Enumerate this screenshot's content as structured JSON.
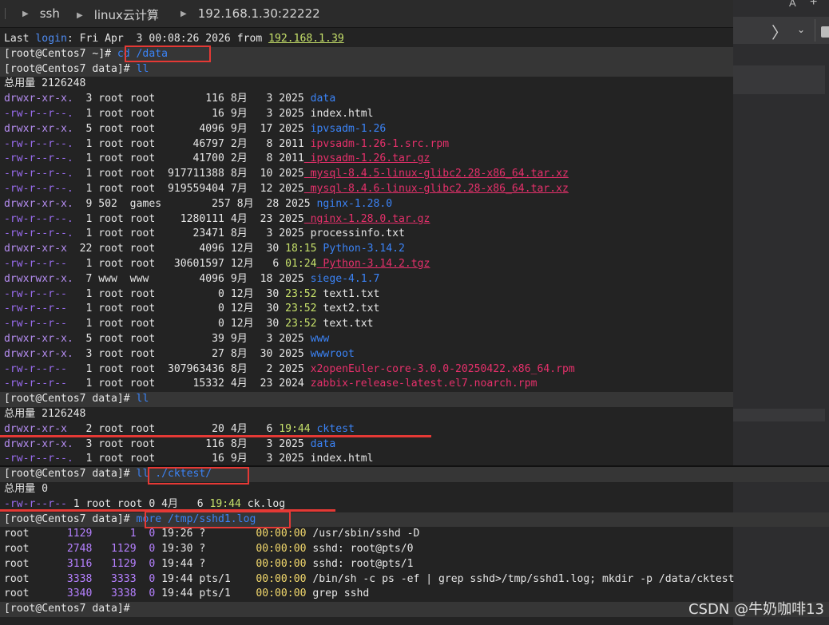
{
  "breadcrumb": [
    "ssh",
    "linux云计算",
    "192.168.1.30:22222"
  ],
  "right_panel": {
    "a_label": "A",
    "plus_label": "+",
    "chevron": "〉",
    "down": "⌄"
  },
  "login": {
    "prefix": "Last ",
    "word": "login",
    "text": ": Fri Apr  3 00:08:26 2026 from ",
    "ip": "192.168.1.39"
  },
  "prompt": "[root@Centos7 data]#",
  "prompt_home": "[root@Centos7 ~]#",
  "cmd1": "cd /data",
  "cmd2": "ll",
  "total1": "总用量 2126248",
  "listing1": [
    {
      "perm": "drwxr-xr-x.",
      "n": " 3",
      "u": "root",
      "g": "root",
      "size": "      116",
      "mon": "8月",
      "day": " 3",
      "time": "2025",
      "name": "data",
      "cls": "c-blue"
    },
    {
      "perm": "-rw-r--r--.",
      "n": " 1",
      "u": "root",
      "g": "root",
      "size": "       16",
      "mon": "9月",
      "day": " 3",
      "time": "2025",
      "name": "index.html",
      "cls": "num"
    },
    {
      "perm": "drwxr-xr-x.",
      "n": " 5",
      "u": "root",
      "g": "root",
      "size": "     4096",
      "mon": "9月",
      "day": "17",
      "time": "2025",
      "name": "ipvsadm-1.26",
      "cls": "c-blue"
    },
    {
      "perm": "-rw-r--r--.",
      "n": " 1",
      "u": "root",
      "g": "root",
      "size": "    46797",
      "mon": "2月",
      "day": " 8",
      "time": "2011",
      "name": "ipvsadm-1.26-1.src.rpm",
      "cls": "c-red"
    },
    {
      "perm": "-rw-r--r--.",
      "n": " 1",
      "u": "root",
      "g": "root",
      "size": "    41700",
      "mon": "2月",
      "day": " 8",
      "time": "2011",
      "name": "ipvsadm-1.26.tar.gz",
      "cls": "c-redu"
    },
    {
      "perm": "-rw-r--r--.",
      "n": " 1",
      "u": "root",
      "g": "root",
      "size": "917711388",
      "mon": "8月",
      "day": "10",
      "time": "2025",
      "name": "mysql-8.4.5-linux-glibc2.28-x86_64.tar.xz",
      "cls": "c-redu"
    },
    {
      "perm": "-rw-r--r--.",
      "n": " 1",
      "u": "root",
      "g": "root",
      "size": "919559404",
      "mon": "7月",
      "day": "12",
      "time": "2025",
      "name": "mysql-8.4.6-linux-glibc2.28-x86_64.tar.xz",
      "cls": "c-redu"
    },
    {
      "perm": "drwxr-xr-x.",
      "n": " 9",
      "u": "502 ",
      "g": "games",
      "size": "      257",
      "mon": "8月",
      "day": "28",
      "time": "2025",
      "name": "nginx-1.28.0",
      "cls": "c-blue"
    },
    {
      "perm": "-rw-r--r--.",
      "n": " 1",
      "u": "root",
      "g": "root",
      "size": "  1280111",
      "mon": "4月",
      "day": "23",
      "time": "2025",
      "name": "nginx-1.28.0.tar.gz",
      "cls": "c-redu"
    },
    {
      "perm": "-rw-r--r--.",
      "n": " 1",
      "u": "root",
      "g": "root",
      "size": "    23471",
      "mon": "8月",
      "day": " 3",
      "time": "2025",
      "name": "processinfo.txt",
      "cls": "num"
    },
    {
      "perm": "drwxr-xr-x ",
      "n": "22",
      "u": "root",
      "g": "root",
      "size": "     4096",
      "mon": "12月",
      "day": "30",
      "time": "18:15",
      "name": "Python-3.14.2",
      "cls": "c-blue"
    },
    {
      "perm": "-rw-r--r-- ",
      "n": " 1",
      "u": "root",
      "g": "root",
      "size": " 30601597",
      "mon": "12月",
      "day": " 6",
      "time": "01:24",
      "name": "Python-3.14.2.tgz",
      "cls": "c-redu"
    },
    {
      "perm": "drwxrwxr-x.",
      "n": " 7",
      "u": "www ",
      "g": "www ",
      "size": "     4096",
      "mon": "9月",
      "day": "18",
      "time": "2025",
      "name": "siege-4.1.7",
      "cls": "c-blue"
    },
    {
      "perm": "-rw-r--r-- ",
      "n": " 1",
      "u": "root",
      "g": "root",
      "size": "        0",
      "mon": "12月",
      "day": "30",
      "time": "23:52",
      "name": "text1.txt",
      "cls": "num"
    },
    {
      "perm": "-rw-r--r-- ",
      "n": " 1",
      "u": "root",
      "g": "root",
      "size": "        0",
      "mon": "12月",
      "day": "30",
      "time": "23:52",
      "name": "text2.txt",
      "cls": "num"
    },
    {
      "perm": "-rw-r--r-- ",
      "n": " 1",
      "u": "root",
      "g": "root",
      "size": "        0",
      "mon": "12月",
      "day": "30",
      "time": "23:52",
      "name": "text.txt",
      "cls": "num"
    },
    {
      "perm": "drwxr-xr-x.",
      "n": " 5",
      "u": "root",
      "g": "root",
      "size": "       39",
      "mon": "9月",
      "day": " 3",
      "time": "2025",
      "name": "www",
      "cls": "c-blue"
    },
    {
      "perm": "drwxr-xr-x.",
      "n": " 3",
      "u": "root",
      "g": "root",
      "size": "       27",
      "mon": "8月",
      "day": "30",
      "time": "2025",
      "name": "wwwroot",
      "cls": "c-blue"
    },
    {
      "perm": "-rw-r--r-- ",
      "n": " 1",
      "u": "root",
      "g": "root",
      "size": "307963436",
      "mon": "8月",
      "day": " 2",
      "time": "2025",
      "name": "x2openEuler-core-3.0.0-20250422.x86_64.rpm",
      "cls": "c-red"
    },
    {
      "perm": "-rw-r--r-- ",
      "n": " 1",
      "u": "root",
      "g": "root",
      "size": "    15332",
      "mon": "4月",
      "day": "23",
      "time": "2024",
      "name": "zabbix-release-latest.el7.noarch.rpm",
      "cls": "c-red"
    }
  ],
  "total2": "总用量 2126248",
  "listing2": [
    {
      "perm": "drwxr-xr-x ",
      "n": " 2",
      "u": "root",
      "g": "root",
      "size": "       20",
      "mon": "4月",
      "day": " 6",
      "time": "19:44",
      "name": "cktest",
      "cls": "c-blue"
    },
    {
      "perm": "drwxr-xr-x.",
      "n": " 3",
      "u": "root",
      "g": "root",
      "size": "      116",
      "mon": "8月",
      "day": " 3",
      "time": "2025",
      "name": "data",
      "cls": "c-blue"
    },
    {
      "perm": "-rw-r--r--.",
      "n": " 1",
      "u": "root",
      "g": "root",
      "size": "       16",
      "mon": "9月",
      "day": " 3",
      "time": "2025",
      "name": "index.html",
      "cls": "num"
    }
  ],
  "cmd3": "ll ./cktest/",
  "total3": "总用量 0",
  "ck_line": {
    "perm": "-rw-r--r--",
    "n": "1",
    "u": "root",
    "g": "root",
    "size": "0",
    "mon": "4月",
    "day": "6",
    "time": "19:44",
    "name": "ck.log"
  },
  "cmd4": "more /tmp/sshd1.log",
  "ps_rows": [
    {
      "user": "root",
      "pid": "1129",
      "ppid": "   1",
      "c": "0",
      "stime": "19:26",
      "tty": "?    ",
      "time": "00:00:00",
      "cmd": "/usr/sbin/sshd -D"
    },
    {
      "user": "root",
      "pid": "2748",
      "ppid": "1129",
      "c": "0",
      "stime": "19:30",
      "tty": "?    ",
      "time": "00:00:00",
      "cmd": "sshd: root@pts/0"
    },
    {
      "user": "root",
      "pid": "3116",
      "ppid": "1129",
      "c": "0",
      "stime": "19:44",
      "tty": "?    ",
      "time": "00:00:00",
      "cmd": "sshd: root@pts/1"
    },
    {
      "user": "root",
      "pid": "3338",
      "ppid": "3333",
      "c": "0",
      "stime": "19:44",
      "tty": "pts/1",
      "time": "00:00:00",
      "cmd": "/bin/sh -c ps -ef | grep sshd>/tmp/sshd1.log; mkdir -p /data/cktest"
    },
    {
      "user": "root",
      "pid": "3340",
      "ppid": "3338",
      "c": "0",
      "stime": "19:44",
      "tty": "pts/1",
      "time": "00:00:00",
      "cmd": "grep sshd"
    }
  ],
  "watermark": "CSDN @牛奶咖啡13"
}
